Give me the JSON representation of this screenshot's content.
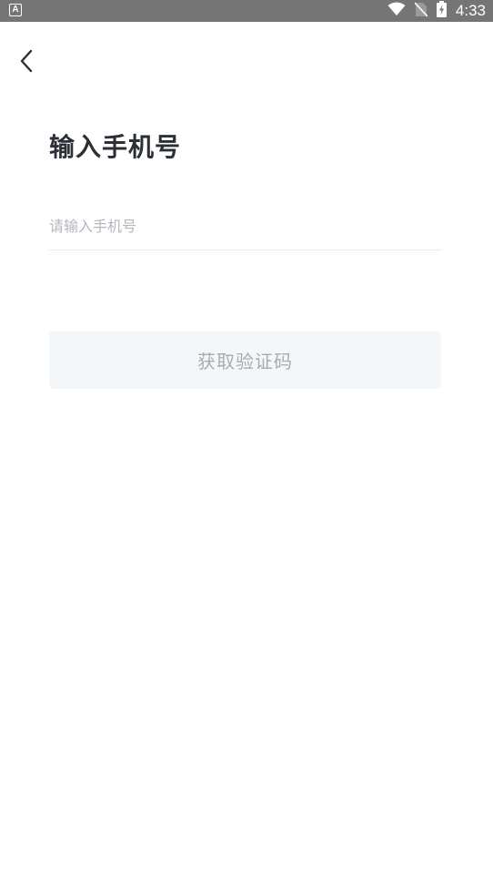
{
  "status_bar": {
    "time": "4:33",
    "left_icon": "A",
    "icons": [
      "wifi-icon",
      "no-sim-icon",
      "battery-charging-icon"
    ]
  },
  "header": {
    "back_icon": "chevron-left-icon"
  },
  "main": {
    "title": "输入手机号",
    "phone_input": {
      "value": "",
      "placeholder": "请输入手机号"
    },
    "get_code_button": {
      "label": "获取验证码"
    }
  },
  "colors": {
    "status_bar_bg": "#757575",
    "title_text": "#2b2f36",
    "placeholder_text": "#b3b6bd",
    "button_bg": "#f4f7fa",
    "button_text": "#a8abb2",
    "divider": "#ececec"
  }
}
